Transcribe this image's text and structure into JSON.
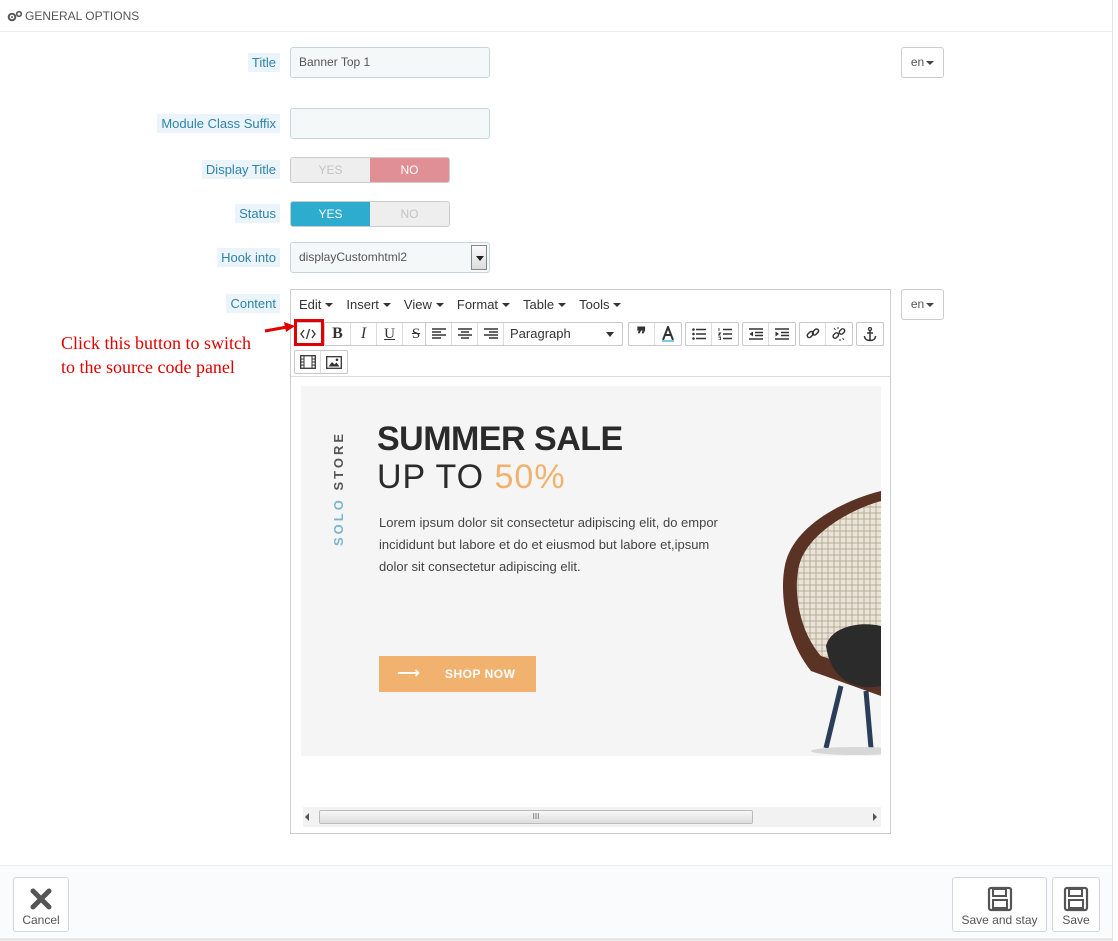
{
  "panel": {
    "heading": "GENERAL OPTIONS"
  },
  "form": {
    "title_label": "Title",
    "title_value": "Banner Top 1",
    "module_class_suffix_label": "Module Class Suffix",
    "module_class_suffix_value": "",
    "display_title_label": "Display Title",
    "display_title_yes": "YES",
    "display_title_no": "NO",
    "status_label": "Status",
    "status_yes": "YES",
    "status_no": "NO",
    "hook_into_label": "Hook into",
    "hook_into_value": "displayCustomhtml2",
    "content_label": "Content",
    "lang": "en"
  },
  "editor": {
    "menu": [
      "Edit",
      "Insert",
      "View",
      "Format",
      "Table",
      "Tools"
    ],
    "format_select": "Paragraph",
    "banner": {
      "vertical_text_1": "SOLO",
      "vertical_text_2": "STORE",
      "heading": "SUMMER SALE",
      "subheading_prefix": "UP TO ",
      "subheading_percent": "50%",
      "body": "Lorem ipsum dolor sit consectetur adipiscing elit, do empor incididunt but labore et  do et eiusmod but labore et,ipsum dolor sit consectetur adipiscing elit.",
      "button_arrow": "⟶",
      "button_label": "SHOP NOW"
    },
    "scroll_grip": "III"
  },
  "annotation": {
    "line1": "Click this button to switch",
    "line2": "to the source code panel",
    "color": "#e00000"
  },
  "footer": {
    "cancel": "Cancel",
    "save_and_stay": "Save and stay",
    "save": "Save"
  },
  "colors": {
    "label_text": "#2f83a8",
    "switch_no_active": "#e08f95",
    "switch_yes_active": "#2eacce",
    "accent_orange": "#f1b26f",
    "accent_blue": "#7bb6cf"
  }
}
